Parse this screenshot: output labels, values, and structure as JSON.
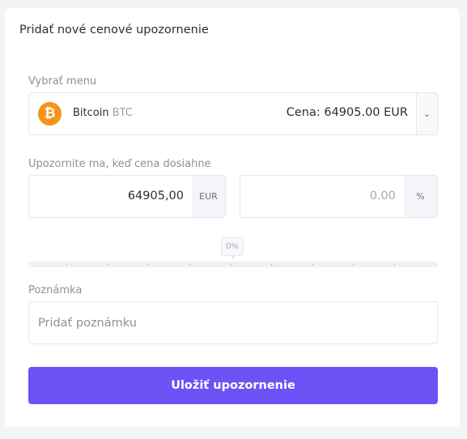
{
  "title": "Pridať nové cenové upozornenie",
  "select": {
    "label": "Vybrať menu",
    "coin_icon": "bitcoin-icon",
    "coin_glyph": "₿",
    "coin_name": "Bitcoin",
    "coin_symbol": "BTC",
    "price_text": "Cena: 64905.00 EUR",
    "dropdown_icon": "chevron-down-icon",
    "dropdown_glyph": "⌄"
  },
  "alert": {
    "label": "Upozornite ma, keď cena dosiahne",
    "amount_value": "64905,00",
    "amount_suffix": "EUR",
    "percent_value": "0.00",
    "percent_suffix": "%"
  },
  "slider": {
    "value_label": "0%",
    "value_percent": 0
  },
  "note": {
    "label": "Poznámka",
    "placeholder": "Pridať poznámku"
  },
  "save_button": "Uložiť upozornenie",
  "colors": {
    "accent": "#6c52f5",
    "bitcoin": "#f7931a"
  }
}
